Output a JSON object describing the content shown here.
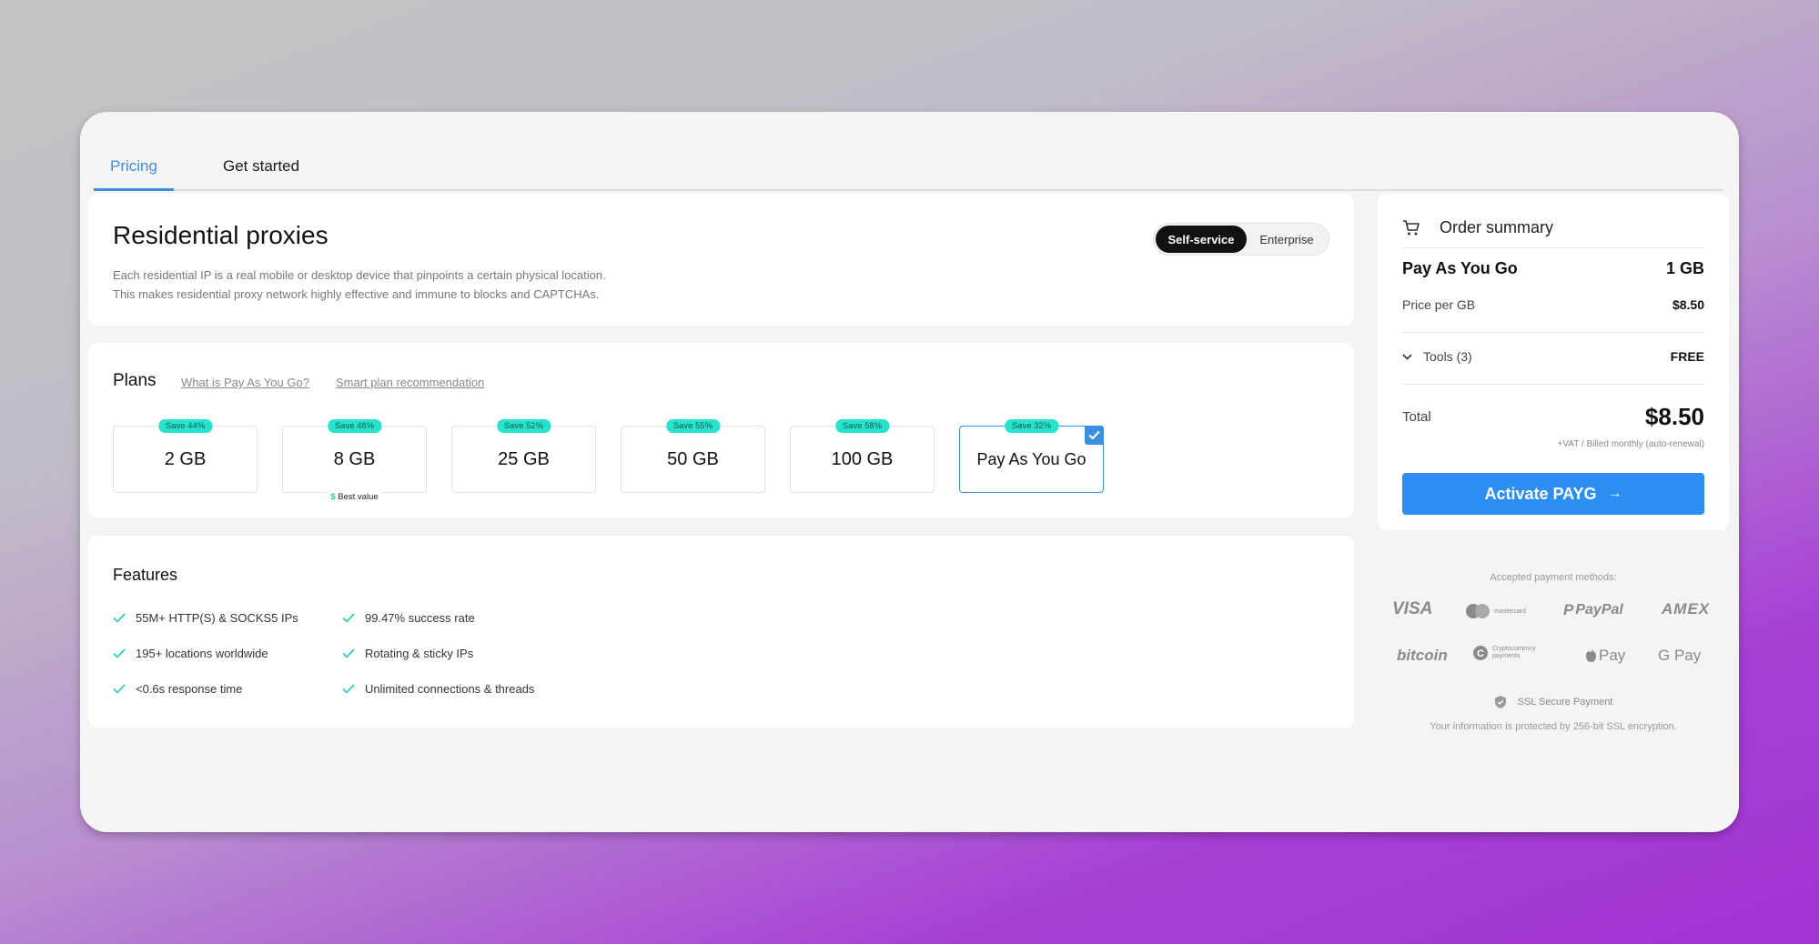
{
  "tabs": [
    {
      "label": "Pricing",
      "active": true
    },
    {
      "label": "Get started",
      "active": false
    }
  ],
  "header": {
    "title": "Residential proxies",
    "desc_line1": "Each residential IP is a real mobile or desktop device that pinpoints a certain physical location.",
    "desc_line2": "This makes residential proxy network highly effective and immune to blocks and CAPTCHAs.",
    "toggle": {
      "selected": "Self-service",
      "other": "Enterprise"
    }
  },
  "plans": {
    "title": "Plans",
    "link1": "What is Pay As You Go?",
    "link2": "Smart plan recommendation",
    "items": [
      {
        "name": "2 GB",
        "save": "Save 44%"
      },
      {
        "name": "8 GB",
        "save": "Save 48%",
        "badge": "Best value",
        "badge_icon": "$"
      },
      {
        "name": "25 GB",
        "save": "Save 52%"
      },
      {
        "name": "50 GB",
        "save": "Save 55%"
      },
      {
        "name": "100 GB",
        "save": "Save 58%"
      },
      {
        "name": "Pay As You Go",
        "save": "Save 32%",
        "selected": true
      }
    ]
  },
  "features": {
    "title": "Features",
    "items": [
      "55M+ HTTP(S) & SOCKS5 IPs",
      "195+ locations worldwide",
      "<0.6s response time",
      "99.47% success rate",
      "Rotating & sticky IPs",
      "Unlimited connections & threads"
    ]
  },
  "order": {
    "title": "Order summary",
    "plan_name": "Pay As You Go",
    "plan_qty": "1 GB",
    "price_label": "Price per GB",
    "price_value": "$8.50",
    "tools_label": "Tools (3)",
    "tools_value": "FREE",
    "total_label": "Total",
    "total_value": "$8.50",
    "vat_note": "+VAT / Billed monthly (auto-renewal)",
    "button": "Activate PAYG"
  },
  "payment": {
    "title": "Accepted payment methods:",
    "methods": [
      "VISA",
      "mastercard",
      "PayPal",
      "AMEX",
      "bitcoin",
      "Cryptocurrency payments",
      "Pay",
      "G Pay"
    ],
    "ssl": "SSL Secure Payment",
    "ssl_note": "Your information is protected by 256-bit SSL encryption."
  },
  "colors": {
    "accent": "#3b8fe0",
    "button": "#2b8ef0",
    "save_badge": "#27e2cd"
  }
}
